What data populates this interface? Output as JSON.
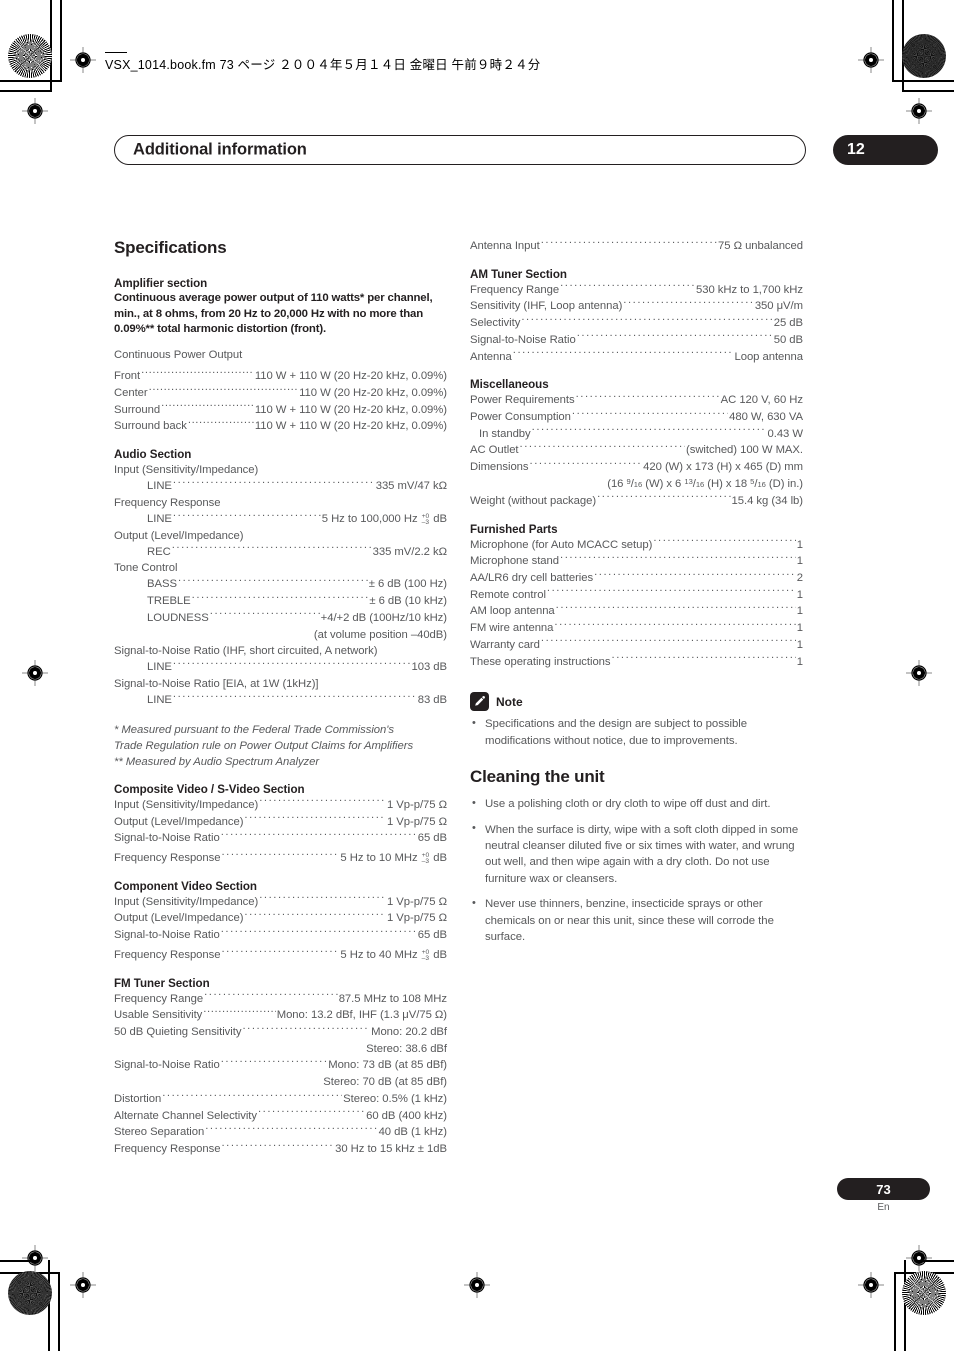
{
  "slug": {
    "text": "VSX_1014.book.fm  73 ページ  ２００４年５月１４日  金曜日  午前９時２４分"
  },
  "header": {
    "chapter_title": "Additional information",
    "chapter_number": "12"
  },
  "footer": {
    "page_number": "73",
    "language": "En"
  },
  "colors": {
    "ink": "#231f20",
    "body_text": "#58595b",
    "page_background": "#ffffff"
  },
  "left_column": {
    "spec_title": "Specifications",
    "amplifier": {
      "heading": "Amplifier section",
      "lead": "Continuous average power output of 110 watts* per channel, min., at 8 ohms, from 20 Hz to 20,000 Hz with no more than 0.09%** total harmonic distortion (front).",
      "subhead": "Continuous Power Output",
      "rows": [
        {
          "label": "Front",
          "value": "110 W + 110 W (20 Hz-20 kHz, 0.09%)"
        },
        {
          "label": "Center",
          "value": "110 W (20 Hz-20 kHz, 0.09%)"
        },
        {
          "label": "Surround",
          "value": "110 W + 110 W (20 Hz-20 kHz, 0.09%)"
        },
        {
          "label": "Surround back",
          "value": "110 W + 110 W (20 Hz-20 kHz, 0.09%)"
        }
      ]
    },
    "audio": {
      "heading": "Audio Section",
      "g1_label": "Input (Sensitivity/Impedance)",
      "g1_row": {
        "label": "LINE",
        "value": "335 mV/47 kΩ"
      },
      "g2_label": "Frequency Response",
      "g2_row": {
        "label": "LINE",
        "value_pre": "5 Hz to 100,000 Hz ",
        "value_post": " dB",
        "stack_top": "+0",
        "stack_bottom": "–3"
      },
      "g3_label": "Output (Level/Impedance)",
      "g3_row": {
        "label": "REC",
        "value": "335 mV/2.2 kΩ"
      },
      "g4_label": "Tone Control",
      "g4_rows": [
        {
          "label": "BASS",
          "value": "± 6 dB (100 Hz)"
        },
        {
          "label": "TREBLE",
          "value": "± 6 dB (10 kHz)"
        },
        {
          "label": "LOUDNESS",
          "value": "+4/+2 dB (100Hz/10 kHz)"
        }
      ],
      "g4_note": "(at volume position –40dB)",
      "g5_label": "Signal-to-Noise Ratio (IHF, short circuited, A network)",
      "g5_row": {
        "label": "LINE",
        "value": "103 dB"
      },
      "g6_label": "Signal-to-Noise Ratio [EIA, at 1W (1kHz)]",
      "g6_row": {
        "label": "LINE",
        "value": "83 dB"
      }
    },
    "footnotes": [
      "* Measured pursuant to the Federal Trade Commission's",
      "Trade Regulation rule on Power Output Claims for Amplifiers",
      "** Measured by Audio Spectrum Analyzer"
    ],
    "composite_video": {
      "heading": "Composite Video / S-Video Section",
      "rows": [
        {
          "label": "Input (Sensitivity/Impedance)",
          "value": "1 Vp-p/75 Ω"
        },
        {
          "label": "Output (Level/Impedance)",
          "value": "1 Vp-p/75 Ω"
        },
        {
          "label": "Signal-to-Noise Ratio",
          "value": "65 dB"
        }
      ],
      "freq_row": {
        "label": "Frequency Response",
        "value_pre": "5 Hz to 10 MHz ",
        "value_post": " dB",
        "stack_top": "+0",
        "stack_bottom": "–3"
      }
    },
    "component_video": {
      "heading": "Component Video Section",
      "rows": [
        {
          "label": "Input (Sensitivity/Impedance)",
          "value": "1 Vp-p/75 Ω"
        },
        {
          "label": "Output (Level/Impedance)",
          "value": "1 Vp-p/75 Ω"
        },
        {
          "label": "Signal-to-Noise Ratio",
          "value": "65 dB"
        }
      ],
      "freq_row": {
        "label": "Frequency Response",
        "value_pre": "5 Hz to 40 MHz ",
        "value_post": " dB",
        "stack_top": "+0",
        "stack_bottom": "–3"
      }
    },
    "fm_tuner": {
      "heading": "FM Tuner Section",
      "rows": [
        {
          "label": "Frequency Range",
          "value": "87.5 MHz to 108 MHz"
        },
        {
          "label": "Usable Sensitivity",
          "value": "Mono: 13.2 dBf, IHF (1.3 μV/75 Ω)"
        },
        {
          "label": "50 dB Quieting Sensitivity",
          "value": "Mono: 20.2 dBf"
        }
      ],
      "cont1": "Stereo: 38.6 dBf",
      "snr_row": {
        "label": "Signal-to-Noise Ratio",
        "value": "Mono: 73 dB (at 85 dBf)"
      },
      "cont2": "Stereo: 70 dB (at 85 dBf)",
      "rows2": [
        {
          "label": "Distortion",
          "value": "Stereo: 0.5% (1 kHz)"
        },
        {
          "label": "Alternate Channel Selectivity",
          "value": "60 dB (400 kHz)"
        },
        {
          "label": "Stereo Separation",
          "value": "40 dB (1 kHz)"
        },
        {
          "label": "Frequency Response",
          "value": "30 Hz to 15 kHz ± 1dB"
        }
      ]
    }
  },
  "right_column": {
    "antenna_row": {
      "label": "Antenna Input",
      "value": "75 Ω unbalanced"
    },
    "am_tuner": {
      "heading": "AM Tuner Section",
      "rows": [
        {
          "label": "Frequency Range",
          "value": "530 kHz to 1,700 kHz"
        },
        {
          "label": "Sensitivity (IHF, Loop antenna)",
          "value": "350 μV/m"
        },
        {
          "label": "Selectivity",
          "value": "25 dB"
        },
        {
          "label": "Signal-to-Noise Ratio",
          "value": "50 dB"
        },
        {
          "label": "Antenna",
          "value": "Loop antenna"
        }
      ]
    },
    "miscellaneous": {
      "heading": "Miscellaneous",
      "rows": [
        {
          "label": "Power Requirements",
          "value": "AC 120 V, 60 Hz"
        },
        {
          "label": "Power Consumption",
          "value": "480 W, 630 VA"
        },
        {
          "label": "In standby",
          "value": "0.43 W",
          "indent": true
        },
        {
          "label": "AC Outlet",
          "value": "(switched) 100 W MAX."
        },
        {
          "label": "Dimensions",
          "value": "420 (W) x 173 (H) x 465 (D) mm"
        }
      ],
      "dimensions_inches": {
        "prefix": "(16 ",
        "f1_num": "9",
        "f1_den": "16",
        "mid1": " (W) x 6 ",
        "f2_num": "13",
        "f2_den": "16",
        "mid2": " (H) x 18 ",
        "f3_num": "5",
        "f3_den": "16",
        "suffix": " (D) in.)"
      },
      "weight_row": {
        "label": "Weight (without package)",
        "value": "15.4 kg (34 lb)"
      }
    },
    "furnished_parts": {
      "heading": "Furnished Parts",
      "rows": [
        {
          "label": "Microphone (for Auto MCACC setup)",
          "value": "1"
        },
        {
          "label": "Microphone stand",
          "value": "1"
        },
        {
          "label": "AA/LR6 dry cell batteries",
          "value": "2"
        },
        {
          "label": "Remote control",
          "value": "1"
        },
        {
          "label": "AM loop antenna",
          "value": "1"
        },
        {
          "label": "FM wire antenna",
          "value": "1"
        },
        {
          "label": "Warranty card",
          "value": "1"
        },
        {
          "label": "These operating instructions",
          "value": "1"
        }
      ]
    },
    "note": {
      "icon": "pencil-icon",
      "label": "Note",
      "bullets": [
        "Specifications and the design are subject to possible modifications without notice, due to improvements."
      ]
    },
    "cleaning": {
      "heading": "Cleaning the unit",
      "bullets": [
        "Use a polishing cloth or dry cloth to wipe off dust and dirt.",
        "When the surface is dirty, wipe with a soft cloth dipped in some neutral cleanser diluted five or six times with water, and wrung out well, and then wipe again with a dry cloth. Do not use furniture wax or cleansers.",
        "Never use thinners, benzine, insecticide sprays or other chemicals on or near this unit, since these will corrode the surface."
      ]
    }
  }
}
